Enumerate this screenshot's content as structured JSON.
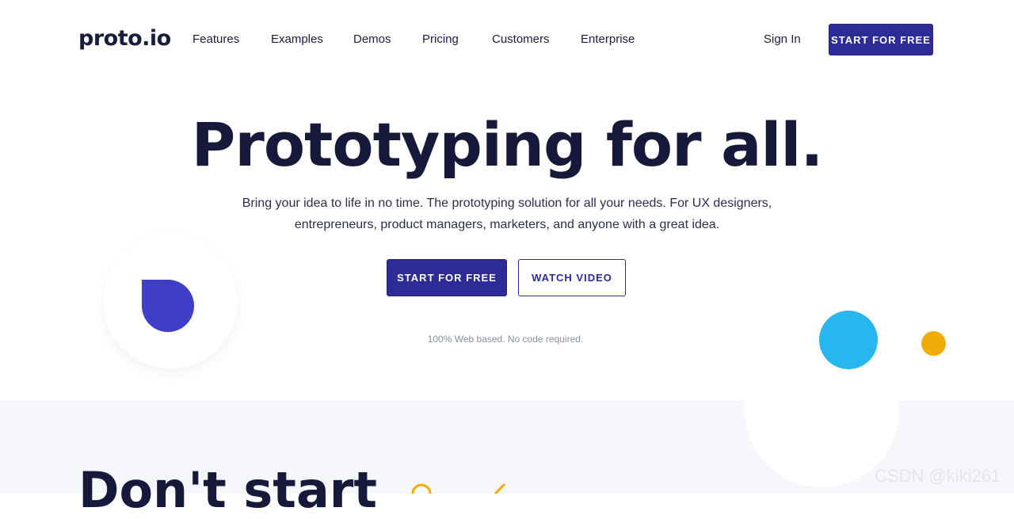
{
  "nav": {
    "logo": "proto.io",
    "links": [
      "Features",
      "Examples",
      "Demos",
      "Pricing",
      "Customers",
      "Enterprise"
    ],
    "sign_in": "Sign In",
    "cta": "START FOR FREE"
  },
  "hero": {
    "title": "Prototyping for all.",
    "subtitle_line1": "Bring your idea to life in no time. The prototyping solution for all your needs. For UX designers,",
    "subtitle_line2": "entrepreneurs, product managers, marketers, and anyone with a great idea.",
    "cta_primary": "START FOR FREE",
    "cta_secondary": "WATCH VIDEO",
    "note": "100% Web based. No code required."
  },
  "section2": {
    "title": "Don't start"
  },
  "watermark": "CSDN @kiki261",
  "colors": {
    "primary": "#2d2b96",
    "accent_blue": "#27b6ee",
    "accent_yellow": "#f2ac0a",
    "accent_purple": "#3f3ec9",
    "text_dark": "#17193b"
  }
}
